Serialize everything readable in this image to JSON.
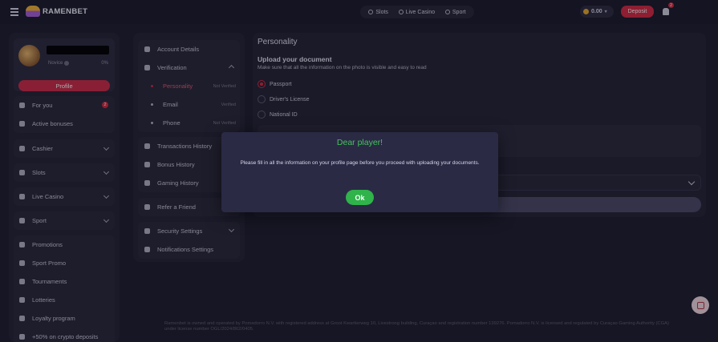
{
  "header": {
    "logo_text": "RAMENBET",
    "nav": [
      {
        "label": "Slots",
        "icon": "slots-icon"
      },
      {
        "label": "Live Casino",
        "icon": "live-casino-icon"
      },
      {
        "label": "Sport",
        "icon": "sport-icon"
      }
    ],
    "balance": "0.00",
    "deposit_label": "Deposit",
    "notifications_count": "2"
  },
  "sidebar": {
    "profile": {
      "rank": "Novice",
      "progress": "0%",
      "button_label": "Profile"
    },
    "groups": [
      [
        {
          "label": "For you",
          "icon": "gift-icon",
          "badge": "2"
        },
        {
          "label": "Active bonuses",
          "icon": "bonus-icon"
        }
      ],
      [
        {
          "label": "Cashier",
          "icon": "wallet-icon",
          "expand": true
        }
      ],
      [
        {
          "label": "Slots",
          "icon": "slots-icon",
          "expand": true
        }
      ],
      [
        {
          "label": "Live Casino",
          "icon": "live-casino-icon",
          "expand": true
        }
      ],
      [
        {
          "label": "Sport",
          "icon": "sport-icon",
          "expand": true
        }
      ],
      [
        {
          "label": "Promotions",
          "icon": "promotions-icon"
        },
        {
          "label": "Sport Promo",
          "icon": "sport-promo-icon"
        },
        {
          "label": "Tournaments",
          "icon": "trophy-icon"
        },
        {
          "label": "Lotteries",
          "icon": "lottery-icon"
        },
        {
          "label": "Loyalty program",
          "icon": "loyalty-icon"
        },
        {
          "label": "+50% on crypto deposits",
          "icon": "crypto-icon"
        }
      ]
    ]
  },
  "account_menu": {
    "account_details": "Account Details",
    "verification": "Verification",
    "verification_items": [
      {
        "label": "Personality",
        "status": "Not Verified",
        "active": true
      },
      {
        "label": "Email",
        "status": "Verified",
        "active": false
      },
      {
        "label": "Phone",
        "status": "Not Verified",
        "active": false
      }
    ],
    "history": [
      "Transactions History",
      "Bonus History",
      "Gaming History"
    ],
    "refer": "Refer a Friend",
    "security": "Security Settings",
    "notifications": "Notifications Settings"
  },
  "main": {
    "title": "Personality",
    "upload_title": "Upload your document",
    "upload_desc": "Make sure that all the information on the photo is visible and easy to read",
    "doc_types": [
      {
        "label": "Passport",
        "selected": true
      },
      {
        "label": "Driver's License",
        "selected": false
      },
      {
        "label": "National ID",
        "selected": false
      }
    ]
  },
  "footer": {
    "text": "Ramenbet is owned and operated by Pomadorro N.V. with registered address at Groot Kwartierweg 10, Livestrong building, Curaçao and registration number 139276. Pomadorro N.V. is licensed and regulated by Curaçao Gaming Authority (CGA) under license number OGL/2024/862/0405."
  },
  "modal": {
    "title": "Dear player!",
    "message": "Please fill in all the information on your profile page before you proceed with uploading your documents.",
    "ok_label": "Ok"
  },
  "colors": {
    "accent_red": "#d4283f",
    "success_green": "#2fb34a",
    "modal_title": "#45c25a",
    "background": "#1d1c2b"
  }
}
